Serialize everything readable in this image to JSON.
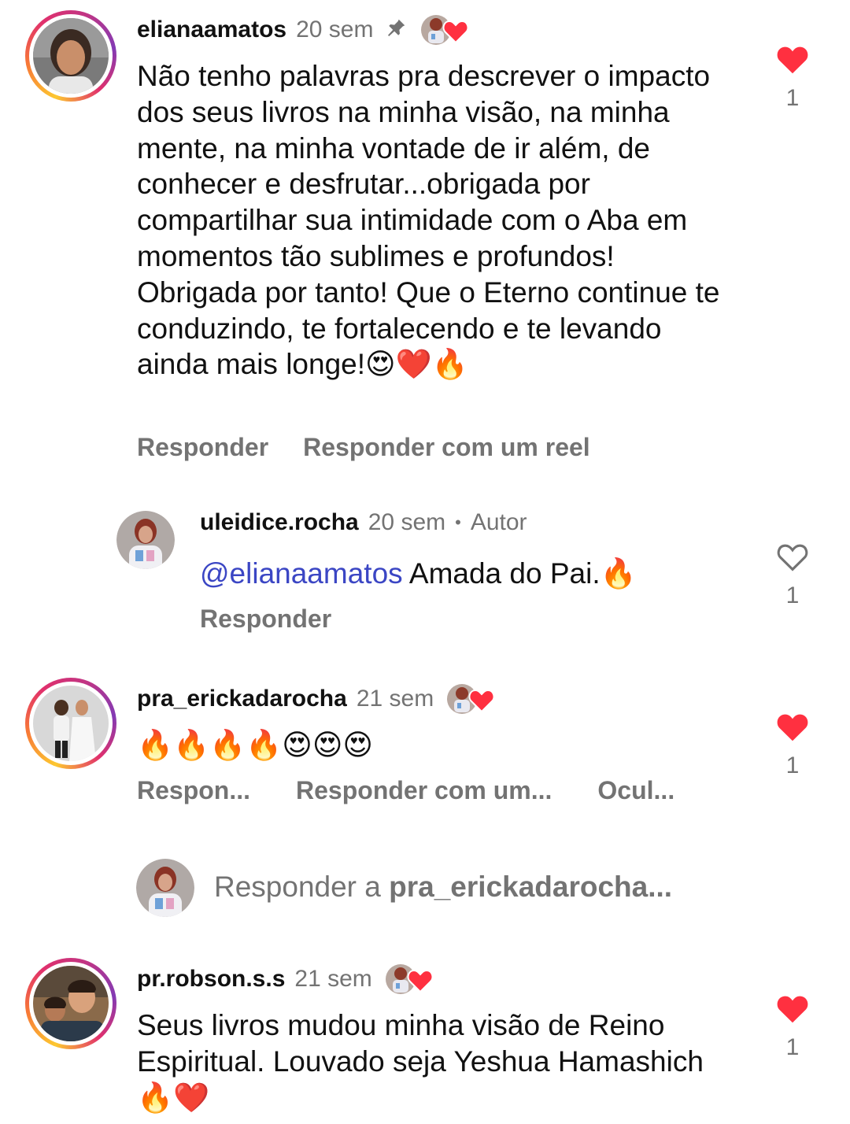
{
  "comments": [
    {
      "username": "elianaamatos",
      "time": "20 sem",
      "text": "Não tenho palavras pra descrever o impacto dos seus livros na minha visão, na minha mente, na minha vontade de ir além, de conhecer e desfrutar...obrigada por compartilhar sua intimidade com o Aba em momentos tão sublimes e profundos! Obrigada por tanto! Que o Eterno continue te conduzindo, te fortalecendo e te levando ainda mais longe!😍❤️🔥",
      "like_count": "1",
      "liked": true,
      "actions": [
        "Responder",
        "Responder com um reel"
      ]
    },
    {
      "username": "uleidice.rocha",
      "time": "20 sem",
      "author_label": "Autor",
      "mention": "@elianaamatos",
      "text": "Amada do Pai.🔥",
      "like_count": "1",
      "liked": false,
      "actions": [
        "Responder"
      ]
    },
    {
      "username": "pra_erickadarocha",
      "time": "21 sem",
      "text": "🔥🔥🔥🔥😍😍😍",
      "like_count": "1",
      "liked": true,
      "actions": [
        "Respon...",
        "Responder com um...",
        "Ocul..."
      ]
    },
    {
      "username": "pr.robson.s.s",
      "time": "21 sem",
      "text": "Seus livros mudou minha visão de Reino Espiritual. Louvado seja Yeshua Hamashich🔥❤️",
      "like_count": "1",
      "liked": true,
      "actions": []
    }
  ],
  "reply_box": {
    "prefix": "Responder a ",
    "target": "pra_erickadarocha..."
  },
  "icons": {
    "pin": "pin-icon",
    "heart_filled": "heart-filled-icon",
    "heart_outline": "heart-outline-icon",
    "creator_liked": "creator-liked-badge"
  },
  "colors": {
    "heart_red": "#ff3040",
    "secondary_text": "#737373",
    "mention_blue": "#3b46c4"
  }
}
